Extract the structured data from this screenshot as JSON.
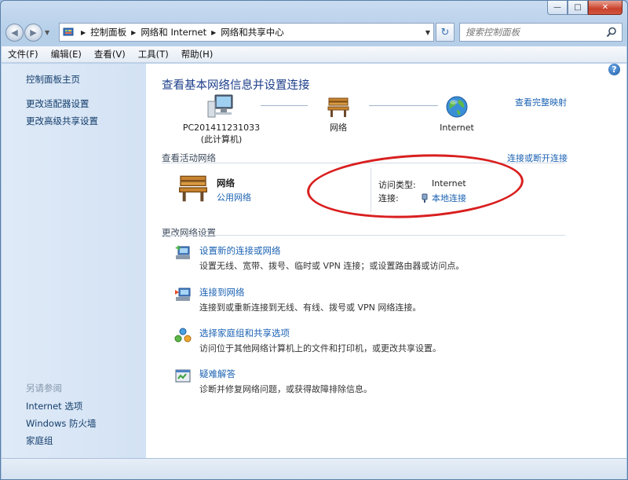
{
  "window": {
    "minimize_glyph": "—",
    "maximize_glyph": "□",
    "close_glyph": "✕"
  },
  "nav": {
    "back_glyph": "◀",
    "forward_glyph": "▶",
    "refresh_glyph": "↻",
    "breadcrumb": [
      "控制面板",
      "网络和 Internet",
      "网络和共享中心"
    ],
    "search_placeholder": "搜索控制面板"
  },
  "menu": [
    "文件(F)",
    "编辑(E)",
    "查看(V)",
    "工具(T)",
    "帮助(H)"
  ],
  "sidebar": {
    "links": [
      "控制面板主页",
      "更改适配器设置",
      "更改高级共享设置"
    ],
    "see_also_title": "另请参阅",
    "see_also": [
      "Internet 选项",
      "Windows 防火墙",
      "家庭组"
    ]
  },
  "main": {
    "help_glyph": "?",
    "heading": "查看基本网络信息并设置连接",
    "map_link": "查看完整映射",
    "nodes": {
      "computer_name": "PC201411231033",
      "computer_sub": "(此计算机)",
      "network": "网络",
      "internet": "Internet"
    },
    "active_section": "查看活动网络",
    "connect_link": "连接或断开连接",
    "active_network": {
      "name": "网络",
      "type": "公用网络",
      "access_label": "访问类型:",
      "access_value": "Internet",
      "connection_label": "连接:",
      "connection_value": "本地连接"
    },
    "change_section": "更改网络设置",
    "tasks": [
      {
        "title": "设置新的连接或网络",
        "desc": "设置无线、宽带、拨号、临时或 VPN 连接；或设置路由器或访问点。"
      },
      {
        "title": "连接到网络",
        "desc": "连接到或重新连接到无线、有线、拨号或 VPN 网络连接。"
      },
      {
        "title": "选择家庭组和共享选项",
        "desc": "访问位于其他网络计算机上的文件和打印机，或更改共享设置。"
      },
      {
        "title": "疑难解答",
        "desc": "诊断并修复网络问题，或获得故障排除信息。"
      }
    ]
  },
  "colors": {
    "link": "#1b62b3",
    "heading": "#1d3e8a",
    "annotation": "#d91f1f"
  }
}
